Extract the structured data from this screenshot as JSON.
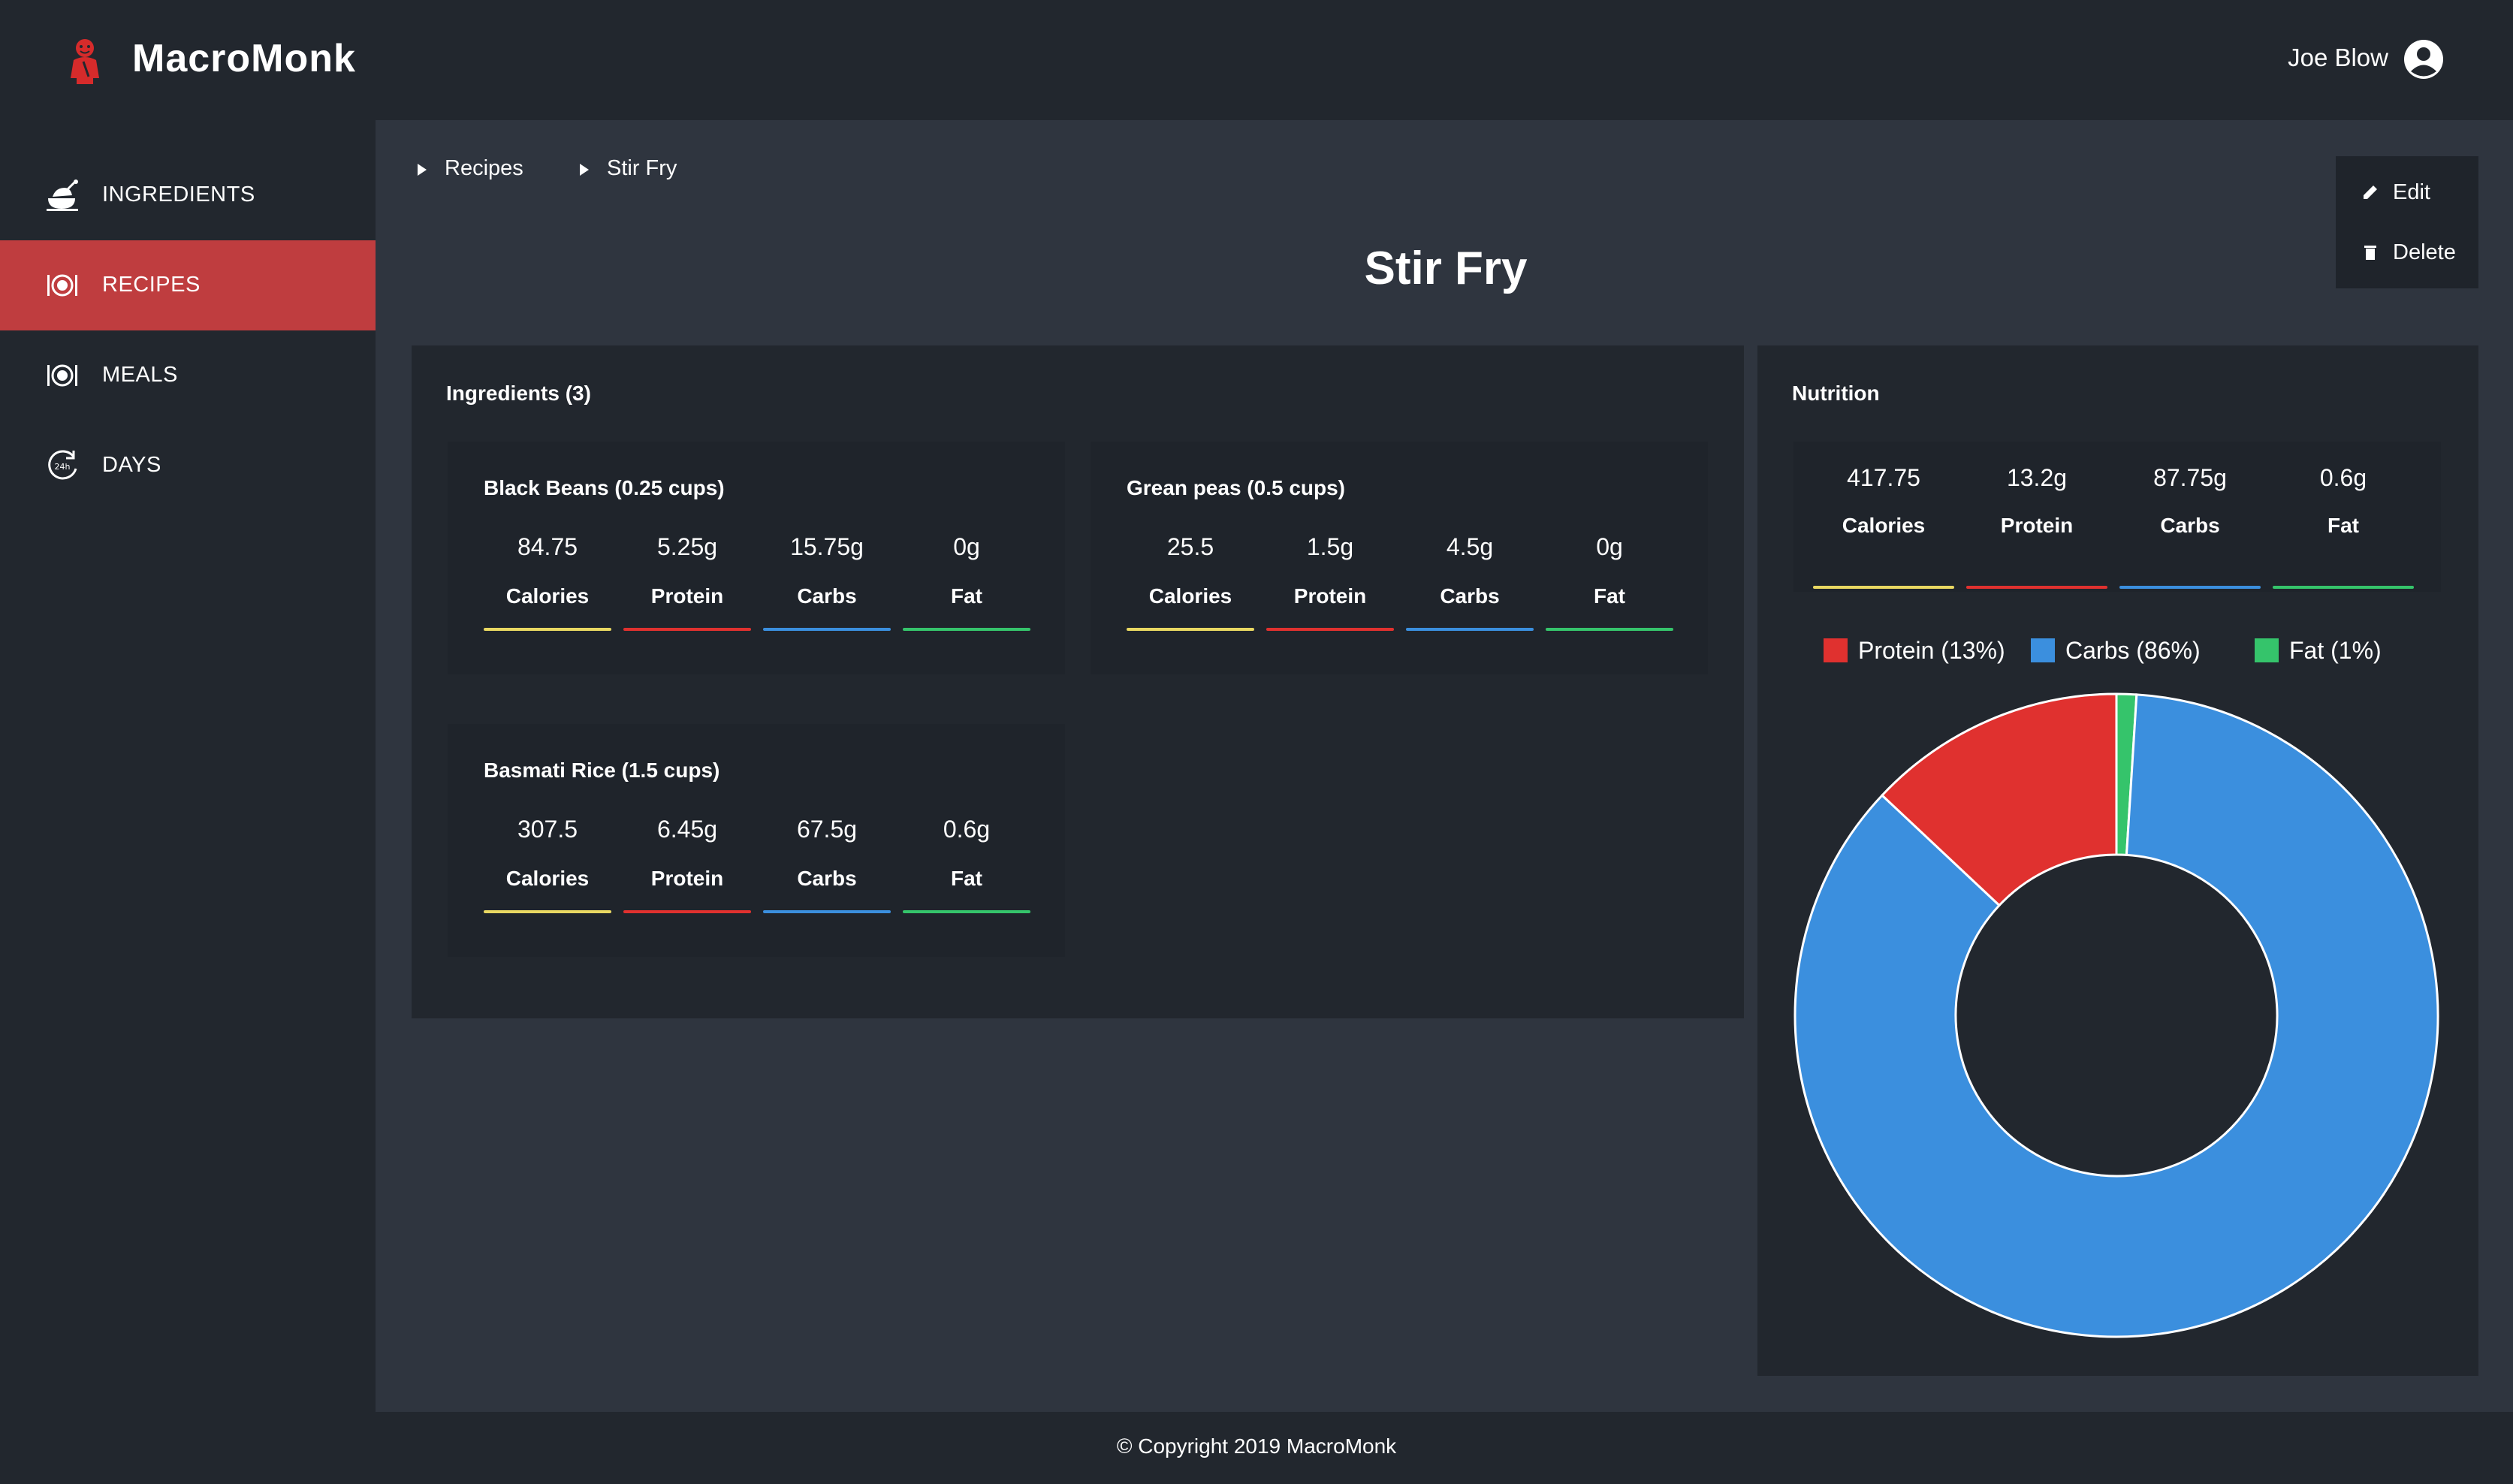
{
  "app": {
    "name": "MacroMonk",
    "user": "Joe Blow"
  },
  "sidebar": {
    "items": [
      {
        "label": "INGREDIENTS",
        "icon": "chicken-icon",
        "active": false
      },
      {
        "label": "RECIPES",
        "icon": "plate-icon",
        "active": true
      },
      {
        "label": "MEALS",
        "icon": "plate-icon",
        "active": false
      },
      {
        "label": "DAYS",
        "icon": "24h-icon",
        "active": false
      }
    ]
  },
  "breadcrumb": [
    "Recipes",
    "Stir Fry"
  ],
  "actions": {
    "edit": "Edit",
    "delete": "Delete"
  },
  "page": {
    "title": "Stir Fry"
  },
  "ingredients": {
    "title": "Ingredients (3)",
    "items": [
      {
        "name": "Black Beans (0.25 cups)",
        "calories": "84.75",
        "protein": "5.25g",
        "carbs": "15.75g",
        "fat": "0g"
      },
      {
        "name": "Grean peas (0.5 cups)",
        "calories": "25.5",
        "protein": "1.5g",
        "carbs": "4.5g",
        "fat": "0g"
      },
      {
        "name": "Basmati Rice (1.5 cups)",
        "calories": "307.5",
        "protein": "6.45g",
        "carbs": "67.5g",
        "fat": "0.6g"
      }
    ]
  },
  "labels": {
    "calories": "Calories",
    "protein": "Protein",
    "carbs": "Carbs",
    "fat": "Fat"
  },
  "nutrition": {
    "title": "Nutrition",
    "calories": "417.75",
    "protein": "13.2g",
    "carbs": "87.75g",
    "fat": "0.6g"
  },
  "colors": {
    "calories": "#e9d862",
    "protein": "#e0312f",
    "carbs": "#3b8fde",
    "fat": "#35c46b",
    "accent": "#bf3d3f"
  },
  "chart_data": {
    "type": "pie",
    "series": [
      {
        "name": "Protein (13%)",
        "value": 13,
        "color": "#e0312f"
      },
      {
        "name": "Carbs (86%)",
        "value": 86,
        "color": "#3b8fde"
      },
      {
        "name": "Fat (1%)",
        "value": 1,
        "color": "#35c46b"
      }
    ],
    "legend": "top"
  },
  "footer": {
    "copyright": "© Copyright 2019 MacroMonk"
  }
}
